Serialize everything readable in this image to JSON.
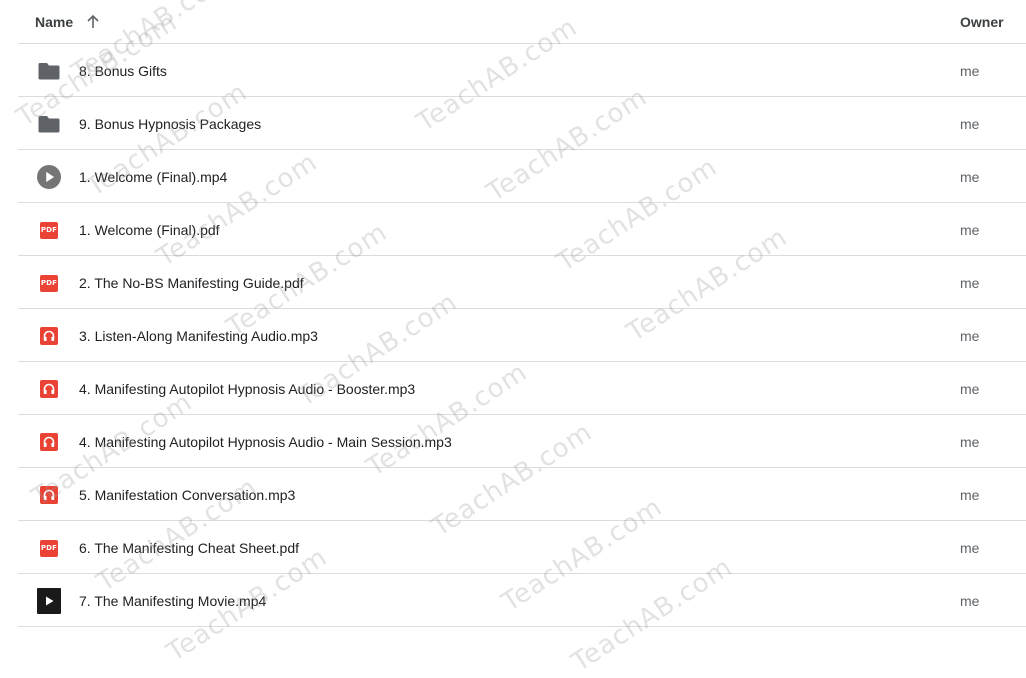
{
  "header": {
    "name_label": "Name",
    "owner_label": "Owner",
    "sort_direction": "ascending",
    "sort_icon": "arrow-up-icon"
  },
  "rows": [
    {
      "name": "8. Bonus Gifts",
      "owner": "me",
      "icon": "folder-icon"
    },
    {
      "name": "9. Bonus Hypnosis Packages",
      "owner": "me",
      "icon": "folder-icon"
    },
    {
      "name": "1. Welcome (Final).mp4",
      "owner": "me",
      "icon": "video-play-icon"
    },
    {
      "name": "1. Welcome (Final).pdf",
      "owner": "me",
      "icon": "pdf-icon"
    },
    {
      "name": "2. The No-BS Manifesting Guide.pdf",
      "owner": "me",
      "icon": "pdf-icon"
    },
    {
      "name": "3. Listen-Along Manifesting Audio.mp3",
      "owner": "me",
      "icon": "audio-icon"
    },
    {
      "name": "4. Manifesting Autopilot Hypnosis Audio - Booster.mp3",
      "owner": "me",
      "icon": "audio-icon"
    },
    {
      "name": "4. Manifesting Autopilot Hypnosis Audio - Main Session.mp3",
      "owner": "me",
      "icon": "audio-icon"
    },
    {
      "name": "5. Manifestation Conversation.mp3",
      "owner": "me",
      "icon": "audio-icon"
    },
    {
      "name": "6. The Manifesting Cheat Sheet.pdf",
      "owner": "me",
      "icon": "pdf-icon"
    },
    {
      "name": "7. The Manifesting Movie.mp4",
      "owner": "me",
      "icon": "video-thumbnail-icon"
    }
  ],
  "pdf_badge_text": "PDF",
  "watermark_text": "TeachAB.com",
  "colors": {
    "folder": "#5f6368",
    "pdf": "#ea4335",
    "audio": "#ea4335",
    "video": "#757575",
    "divider": "#dadce0"
  }
}
